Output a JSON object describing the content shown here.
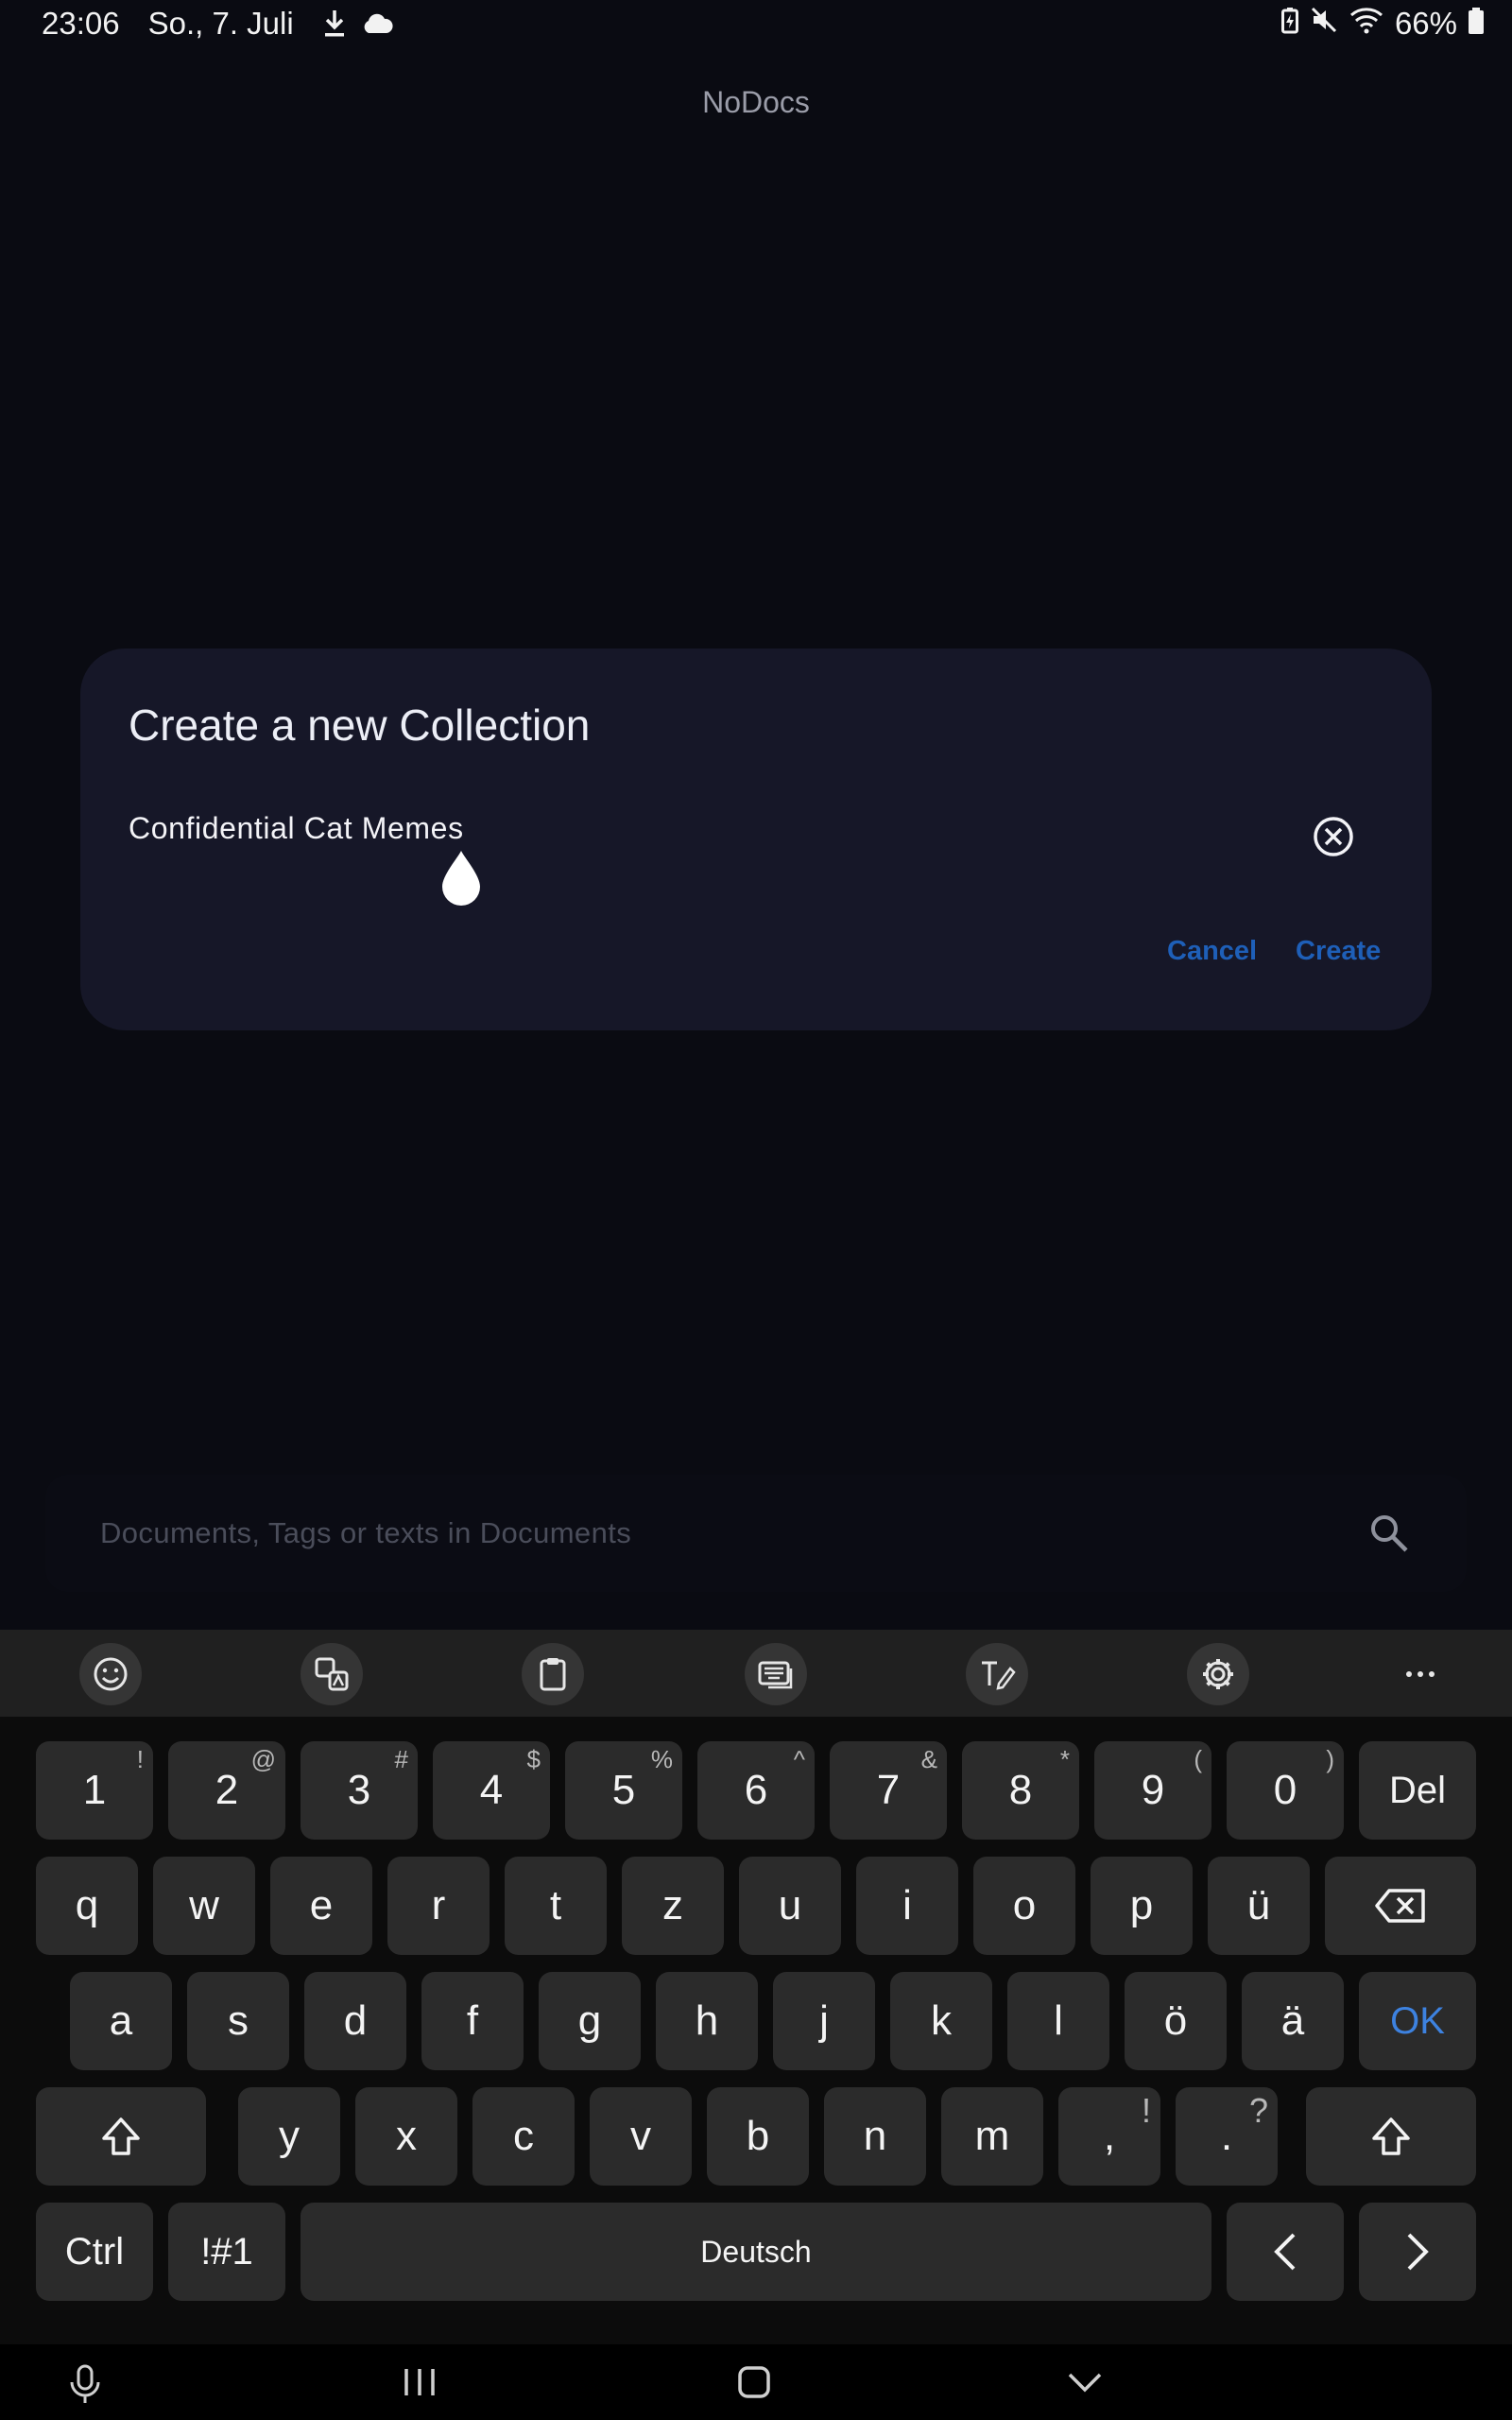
{
  "status_bar": {
    "time": "23:06",
    "date": "So., 7. Juli",
    "battery_percent": "66%",
    "left_icons": [
      "download-icon",
      "cloud-icon"
    ],
    "right_icons": [
      "battery-saver-icon",
      "mute-icon",
      "wifi-icon",
      "battery-icon"
    ]
  },
  "app": {
    "title": "NoDocs"
  },
  "dialog": {
    "title": "Create a new Collection",
    "input_value": "Confidential Cat Memes",
    "cancel_label": "Cancel",
    "create_label": "Create",
    "accent_color": "#1e5fb8"
  },
  "search": {
    "placeholder": "Documents, Tags or texts in Documents"
  },
  "keyboard": {
    "toolbar_icons": [
      "emoji-icon",
      "translate-icon",
      "clipboard-icon",
      "keyboard-mode-icon",
      "handwriting-icon",
      "settings-icon",
      "more-icon"
    ],
    "row1": [
      {
        "label": "1",
        "sub": "!"
      },
      {
        "label": "2",
        "sub": "@"
      },
      {
        "label": "3",
        "sub": "#"
      },
      {
        "label": "4",
        "sub": "$"
      },
      {
        "label": "5",
        "sub": "%"
      },
      {
        "label": "6",
        "sub": "^"
      },
      {
        "label": "7",
        "sub": "&"
      },
      {
        "label": "8",
        "sub": "*"
      },
      {
        "label": "9",
        "sub": "("
      },
      {
        "label": "0",
        "sub": ")"
      },
      {
        "label": "Del",
        "sub": ""
      }
    ],
    "row2": [
      "q",
      "w",
      "e",
      "r",
      "t",
      "z",
      "u",
      "i",
      "o",
      "p",
      "ü"
    ],
    "row3": [
      "a",
      "s",
      "d",
      "f",
      "g",
      "h",
      "j",
      "k",
      "l",
      "ö",
      "ä"
    ],
    "ok_label": "OK",
    "row4": [
      {
        "label": "y",
        "sub": ""
      },
      {
        "label": "x",
        "sub": ""
      },
      {
        "label": "c",
        "sub": ""
      },
      {
        "label": "v",
        "sub": ""
      },
      {
        "label": "b",
        "sub": ""
      },
      {
        "label": "n",
        "sub": ""
      },
      {
        "label": "m",
        "sub": ""
      },
      {
        "label": ",",
        "sub": "!"
      },
      {
        "label": ".",
        "sub": "?"
      }
    ],
    "ctrl_label": "Ctrl",
    "symbols_label": "!#1",
    "space_label": "Deutsch",
    "ok_color": "#3d82e0"
  },
  "nav_bar": {
    "icons": [
      "microphone-icon",
      "recents-icon",
      "home-icon",
      "hide-keyboard-icon"
    ]
  }
}
